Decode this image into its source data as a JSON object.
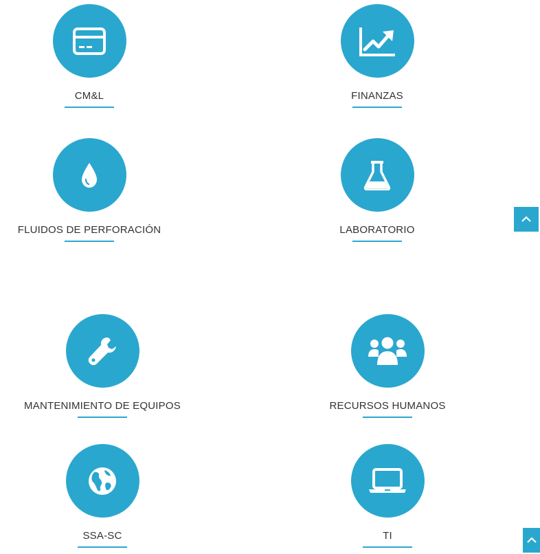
{
  "theme": {
    "accent": "#2aa7cf",
    "text": "#333333"
  },
  "tiles": [
    {
      "label": "CM&L",
      "icon": "credit-card-icon"
    },
    {
      "label": "FINANZAS",
      "icon": "line-chart-icon"
    },
    {
      "label": "FLUIDOS DE PERFORACIÓN",
      "icon": "drop-icon"
    },
    {
      "label": "LABORATORIO",
      "icon": "flask-icon"
    },
    {
      "label": "MANTENIMIENTO DE EQUIPOS",
      "icon": "wrench-icon"
    },
    {
      "label": "RECURSOS HUMANOS",
      "icon": "users-icon"
    },
    {
      "label": "SSA-SC",
      "icon": "globe-icon"
    },
    {
      "label": "TI",
      "icon": "laptop-icon"
    }
  ],
  "scroll_buttons": [
    {
      "icon": "chevron-up-icon"
    },
    {
      "icon": "chevron-up-icon"
    }
  ]
}
